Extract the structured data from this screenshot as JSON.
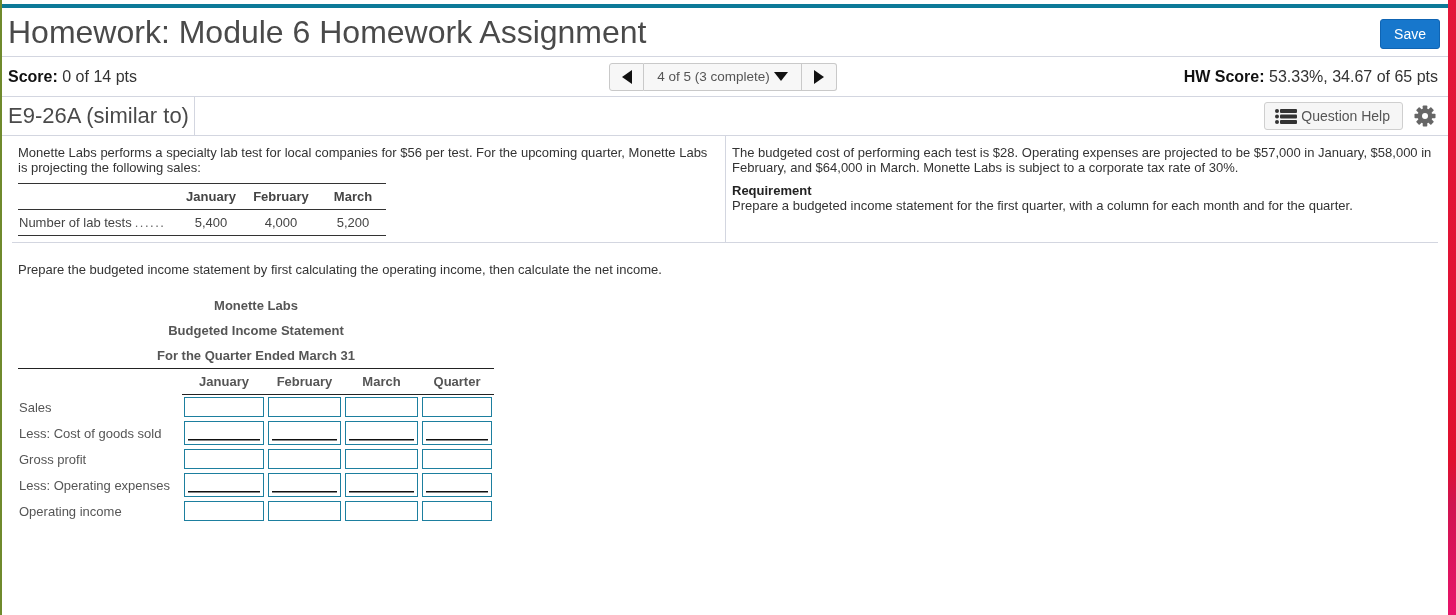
{
  "header": {
    "title": "Homework: Module 6 Homework Assignment",
    "save_button": "Save"
  },
  "score_bar": {
    "score_label": "Score:",
    "score_value": "0 of 14 pts",
    "question_nav": "4 of 5 (3 complete)",
    "hw_score_label": "HW Score:",
    "hw_score_value": "53.33%, 34.67 of 65 pts"
  },
  "question_bar": {
    "question_id": "E9-26A (similar to)",
    "help_button": "Question Help"
  },
  "problem": {
    "intro": "Monette Labs performs a specialty lab test for local companies for $56 per test. For the upcoming quarter, Monette Labs is projecting the following sales:",
    "sales_table": {
      "columns": [
        "January",
        "February",
        "March"
      ],
      "rows": [
        {
          "label": "Number of lab tests",
          "leader": "......",
          "values": [
            "5,400",
            "4,000",
            "5,200"
          ]
        }
      ]
    },
    "details": "The budgeted cost of performing each test is $28. Operating expenses are projected to be $57,000 in January, $58,000 in February, and $64,000 in March. Monette Labs is subject to a corporate tax rate of 30%.",
    "requirement": {
      "heading": "Requirement",
      "text": "Prepare a budgeted income statement for the first quarter, with a column for each month and for the quarter."
    }
  },
  "worksheet": {
    "instruction": "Prepare the budgeted income statement by first calculating the operating income, then calculate the net income.",
    "titles": [
      "Monette Labs",
      "Budgeted Income Statement",
      "For the Quarter Ended March 31"
    ],
    "columns": [
      "January",
      "February",
      "March",
      "Quarter"
    ],
    "rows": [
      {
        "label": "Sales",
        "underlined": false
      },
      {
        "label": "Less: Cost of goods sold",
        "underlined": true
      },
      {
        "label": "Gross profit",
        "underlined": false
      },
      {
        "label": "Less: Operating expenses",
        "underlined": true
      },
      {
        "label": "Operating income",
        "underlined": false
      }
    ]
  }
}
